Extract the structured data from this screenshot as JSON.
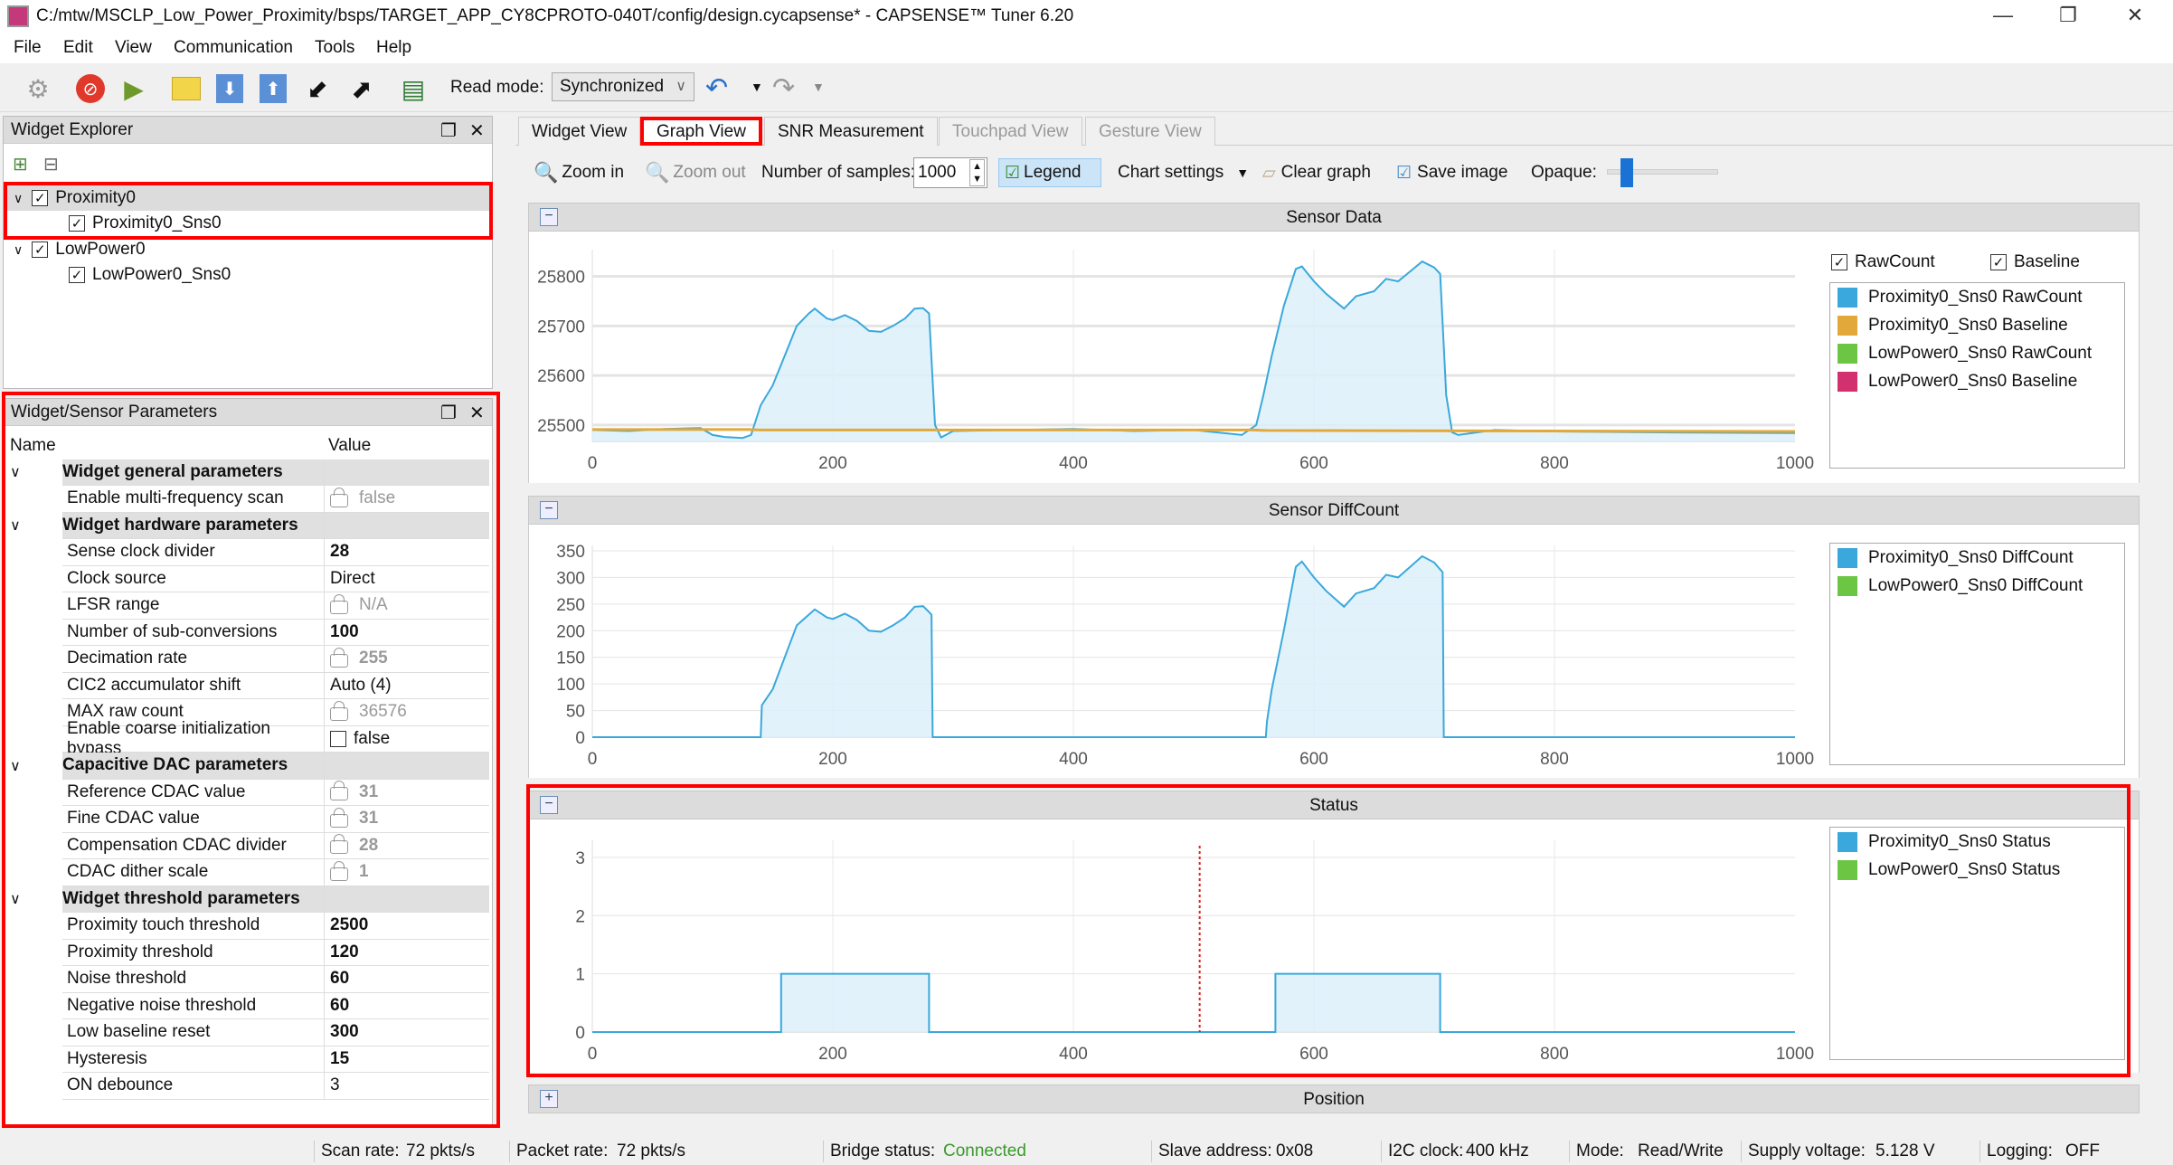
{
  "window": {
    "title": "C:/mtw/MSCLP_Low_Power_Proximity/bsps/TARGET_APP_CY8CPROTO-040T/config/design.cycapsense* - CAPSENSE™ Tuner 6.20",
    "minimize": "—",
    "restore": "❐",
    "close": "✕"
  },
  "menu": [
    "File",
    "Edit",
    "View",
    "Communication",
    "Tools",
    "Help"
  ],
  "toolbar": {
    "read_mode_label": "Read mode:",
    "read_mode_value": "Synchronized",
    "icons": [
      "gear-icon",
      "stop-icon",
      "play-icon",
      "open-folder-icon",
      "download-icon",
      "upload-icon",
      "import-icon",
      "export-icon",
      "log-icon",
      "undo-icon",
      "redo-icon"
    ]
  },
  "widget_explorer": {
    "title": "Widget Explorer",
    "items": [
      {
        "label": "Proximity0",
        "checked": true,
        "level": 0
      },
      {
        "label": "Proximity0_Sns0",
        "checked": true,
        "level": 1
      },
      {
        "label": "LowPower0",
        "checked": true,
        "level": 0
      },
      {
        "label": "LowPower0_Sns0",
        "checked": true,
        "level": 1
      }
    ]
  },
  "params": {
    "title": "Widget/Sensor Parameters",
    "col_name": "Name",
    "col_value": "Value",
    "rows": [
      {
        "type": "group",
        "name": "Widget general parameters"
      },
      {
        "type": "item",
        "name": "Enable multi-frequency scan",
        "value": "false",
        "locked": true,
        "bold": false
      },
      {
        "type": "group",
        "name": "Widget hardware parameters"
      },
      {
        "type": "item",
        "name": "Sense clock divider",
        "value": "28",
        "locked": false,
        "bold": true
      },
      {
        "type": "item",
        "name": "Clock source",
        "value": "Direct",
        "locked": false,
        "bold": false
      },
      {
        "type": "item",
        "name": "LFSR range",
        "value": "N/A",
        "locked": true,
        "bold": false
      },
      {
        "type": "item",
        "name": "Number of sub-conversions",
        "value": "100",
        "locked": false,
        "bold": true
      },
      {
        "type": "item",
        "name": "Decimation rate",
        "value": "255",
        "locked": true,
        "bold": true
      },
      {
        "type": "item",
        "name": "CIC2 accumulator shift",
        "value": "Auto (4)",
        "locked": false,
        "bold": false
      },
      {
        "type": "item",
        "name": "MAX raw count",
        "value": "36576",
        "locked": true,
        "bold": false
      },
      {
        "type": "item",
        "name": "Enable coarse initialization bypass",
        "value": "false",
        "checkbox": true,
        "bold": false
      },
      {
        "type": "group",
        "name": "Capacitive DAC parameters"
      },
      {
        "type": "item",
        "name": "Reference CDAC value",
        "value": "31",
        "locked": true,
        "bold": true
      },
      {
        "type": "item",
        "name": "Fine CDAC value",
        "value": "31",
        "locked": true,
        "bold": true
      },
      {
        "type": "item",
        "name": "Compensation CDAC divider",
        "value": "28",
        "locked": true,
        "bold": true
      },
      {
        "type": "item",
        "name": "CDAC dither scale",
        "value": "1",
        "locked": true,
        "bold": true
      },
      {
        "type": "group",
        "name": "Widget threshold parameters"
      },
      {
        "type": "item",
        "name": "Proximity touch threshold",
        "value": "2500",
        "locked": false,
        "bold": true
      },
      {
        "type": "item",
        "name": "Proximity threshold",
        "value": "120",
        "locked": false,
        "bold": true
      },
      {
        "type": "item",
        "name": "Noise threshold",
        "value": "60",
        "locked": false,
        "bold": true
      },
      {
        "type": "item",
        "name": "Negative noise threshold",
        "value": "60",
        "locked": false,
        "bold": true
      },
      {
        "type": "item",
        "name": "Low baseline reset",
        "value": "300",
        "locked": false,
        "bold": true
      },
      {
        "type": "item",
        "name": "Hysteresis",
        "value": "15",
        "locked": false,
        "bold": true
      },
      {
        "type": "item",
        "name": "ON debounce",
        "value": "3",
        "locked": false,
        "bold": false
      }
    ]
  },
  "tabs": [
    {
      "label": "Widget View",
      "state": "normal"
    },
    {
      "label": "Graph View",
      "state": "selected"
    },
    {
      "label": "SNR Measurement",
      "state": "normal"
    },
    {
      "label": "Touchpad View",
      "state": "disabled"
    },
    {
      "label": "Gesture View",
      "state": "disabled"
    }
  ],
  "graph_toolbar": {
    "zoom_in": "Zoom in",
    "zoom_out": "Zoom out",
    "samples_label": "Number of samples:",
    "samples_value": "1000",
    "legend": "Legend",
    "chart_settings": "Chart settings",
    "clear_graph": "Clear graph",
    "save_image": "Save image",
    "opaque_label": "Opaque:",
    "opaque_level": 0.15
  },
  "sections": {
    "sensor_data": "Sensor Data",
    "diffcount": "Sensor DiffCount",
    "status": "Status",
    "position": "Position"
  },
  "sensor_data_checks": {
    "rawcount": "RawCount",
    "baseline": "Baseline"
  },
  "colors": {
    "blue": "#3aa8dc",
    "orange": "#e2a93a",
    "green": "#6cc644",
    "magenta": "#d3306f",
    "fill": "#dcf0fa",
    "cursor": "#e02020"
  },
  "chart_data": [
    {
      "type": "area",
      "title": "Sensor Data",
      "xlim": [
        0,
        1000
      ],
      "ylim": [
        25467,
        25843
      ],
      "xticks": [
        0,
        200,
        400,
        600,
        800,
        1000
      ],
      "yticks": [
        25500,
        25600,
        25700,
        25800
      ],
      "grid": true,
      "legend": "right",
      "legend_entries": [
        {
          "name": "Proximity0_Sns0 RawCount",
          "color": "#3aa8dc"
        },
        {
          "name": "Proximity0_Sns0 Baseline",
          "color": "#e2a93a"
        },
        {
          "name": "LowPower0_Sns0 RawCount",
          "color": "#6cc644"
        },
        {
          "name": "LowPower0_Sns0 Baseline",
          "color": "#d3306f"
        }
      ],
      "series": [
        {
          "name": "Proximity0_Sns0 RawCount",
          "color": "#3aa8dc",
          "fill": true,
          "x": [
            0,
            30,
            60,
            90,
            100,
            110,
            125,
            132,
            140,
            150,
            160,
            170,
            180,
            185,
            195,
            200,
            210,
            220,
            230,
            240,
            250,
            260,
            268,
            275,
            280,
            285,
            290,
            300,
            350,
            400,
            450,
            500,
            540,
            552,
            558,
            565,
            575,
            585,
            590,
            600,
            610,
            620,
            625,
            635,
            650,
            660,
            670,
            680,
            690,
            700,
            705,
            710,
            715,
            720,
            750,
            800,
            900,
            1000
          ],
          "y": [
            25490,
            25488,
            25492,
            25494,
            25480,
            25476,
            25474,
            25480,
            25540,
            25580,
            25640,
            25700,
            25725,
            25735,
            25715,
            25712,
            25722,
            25710,
            25690,
            25688,
            25700,
            25715,
            25735,
            25736,
            25725,
            25500,
            25475,
            25488,
            25490,
            25492,
            25488,
            25490,
            25480,
            25500,
            25560,
            25640,
            25740,
            25815,
            25820,
            25790,
            25765,
            25745,
            25735,
            25760,
            25770,
            25795,
            25790,
            25810,
            25830,
            25818,
            25805,
            25560,
            25485,
            25480,
            25490,
            25487,
            25485,
            25484
          ]
        },
        {
          "name": "Proximity0_Sns0 Baseline",
          "color": "#e2a93a",
          "fill": false,
          "x": [
            0,
            130,
            140,
            550,
            560,
            1000
          ],
          "y": [
            25491,
            25491,
            25490,
            25490,
            25489,
            25487
          ]
        }
      ]
    },
    {
      "type": "area",
      "title": "Sensor DiffCount",
      "xlim": [
        0,
        1000
      ],
      "ylim": [
        0,
        350
      ],
      "xticks": [
        0,
        200,
        400,
        600,
        800,
        1000
      ],
      "yticks": [
        0,
        50,
        100,
        150,
        200,
        250,
        300,
        350
      ],
      "grid": true,
      "legend": "right",
      "legend_entries": [
        {
          "name": "Proximity0_Sns0 DiffCount",
          "color": "#3aa8dc"
        },
        {
          "name": "LowPower0_Sns0 DiffCount",
          "color": "#6cc644"
        }
      ],
      "series": [
        {
          "name": "Proximity0_Sns0 DiffCount",
          "color": "#3aa8dc",
          "fill": true,
          "x": [
            0,
            140,
            141,
            150,
            160,
            170,
            180,
            185,
            195,
            200,
            210,
            220,
            230,
            240,
            250,
            260,
            268,
            275,
            280,
            282,
            283,
            560,
            561,
            565,
            575,
            585,
            590,
            600,
            610,
            620,
            625,
            635,
            650,
            660,
            670,
            680,
            690,
            700,
            705,
            707,
            708,
            1000
          ],
          "y": [
            0,
            0,
            60,
            90,
            150,
            210,
            230,
            240,
            225,
            222,
            232,
            220,
            200,
            198,
            210,
            225,
            245,
            246,
            235,
            230,
            0,
            0,
            30,
            90,
            200,
            320,
            330,
            300,
            275,
            255,
            245,
            270,
            280,
            305,
            300,
            320,
            340,
            328,
            315,
            310,
            0,
            0
          ]
        }
      ]
    },
    {
      "type": "area",
      "title": "Status",
      "xlim": [
        0,
        1000
      ],
      "ylim": [
        0,
        3.2
      ],
      "xticks": [
        0,
        200,
        400,
        600,
        800,
        1000
      ],
      "yticks": [
        0,
        1,
        2,
        3
      ],
      "grid": true,
      "legend": "right",
      "cursor_x": 505,
      "legend_entries": [
        {
          "name": "Proximity0_Sns0 Status",
          "color": "#3aa8dc"
        },
        {
          "name": "LowPower0_Sns0 Status",
          "color": "#6cc644"
        }
      ],
      "series": [
        {
          "name": "Proximity0_Sns0 Status",
          "color": "#3aa8dc",
          "fill": true,
          "x": [
            0,
            157,
            157,
            280,
            280,
            568,
            568,
            705,
            705,
            1000
          ],
          "y": [
            0,
            0,
            1,
            1,
            0,
            0,
            1,
            1,
            0,
            0
          ]
        }
      ]
    }
  ],
  "statusbar": [
    {
      "label": "Scan rate:",
      "value": "72 pkts/s"
    },
    {
      "label": "Packet rate:",
      "value": "72 pkts/s"
    },
    {
      "label": "Bridge status:",
      "value": "Connected"
    },
    {
      "label": "Slave address:",
      "value": "0x08"
    },
    {
      "label": "I2C clock:",
      "value": "400 kHz"
    },
    {
      "label": "Mode:",
      "value": "Read/Write"
    },
    {
      "label": "Supply voltage:",
      "value": "5.128 V"
    },
    {
      "label": "Logging:",
      "value": "OFF"
    }
  ]
}
